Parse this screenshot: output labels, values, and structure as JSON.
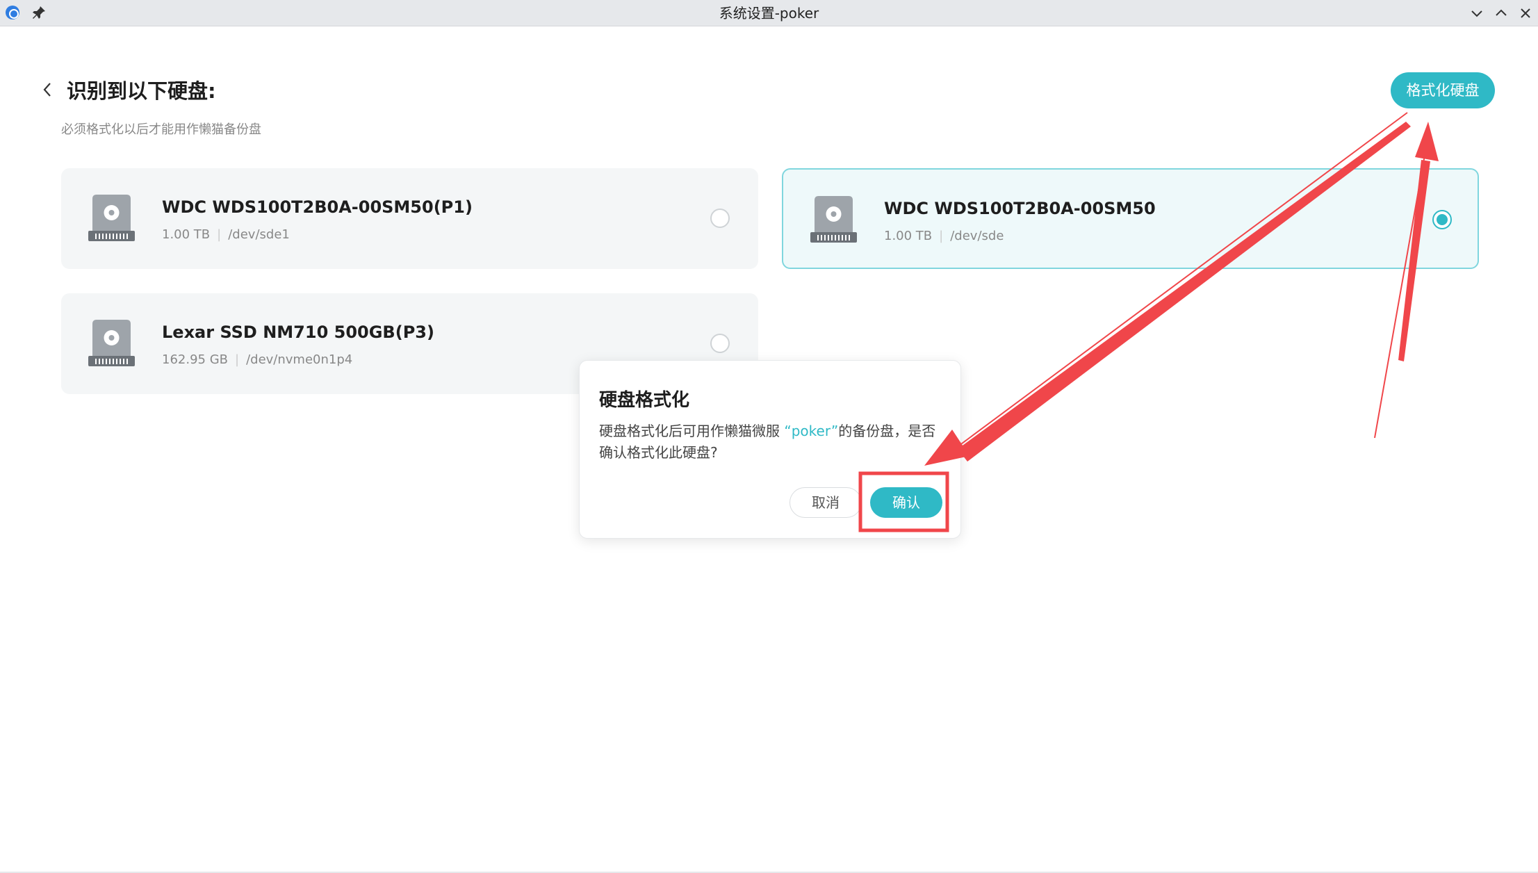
{
  "window": {
    "title": "系统设置-poker",
    "icons": {
      "app": "app-logo-icon",
      "pin": "pin-icon",
      "minimize": "chevron-down-icon",
      "maximize": "chevron-up-icon",
      "close": "close-icon"
    }
  },
  "header": {
    "back_icon": "chevron-left-icon",
    "title": "识别到以下硬盘:",
    "subtitle": "必须格式化以后才能用作懒猫备份盘",
    "format_button": "格式化硬盘"
  },
  "disks": [
    {
      "name": "WDC WDS100T2B0A-00SM50(P1)",
      "size": "1.00 TB",
      "sep": "|",
      "path": "/dev/sde1",
      "selected": false,
      "icon": "hard-drive-icon"
    },
    {
      "name": "WDC WDS100T2B0A-00SM50",
      "size": "1.00 TB",
      "sep": "|",
      "path": "/dev/sde",
      "selected": true,
      "icon": "hard-drive-icon"
    },
    {
      "name": "Lexar SSD NM710 500GB(P3)",
      "size": "162.95 GB",
      "sep": "|",
      "path": "/dev/nvme0n1p4",
      "selected": false,
      "icon": "hard-drive-icon"
    }
  ],
  "dialog": {
    "title": "硬盘格式化",
    "body_before": "硬盘格式化后可用作懒猫微服 ",
    "body_highlight": "“poker”",
    "body_after": "的备份盘，是否确认格式化此硬盘?",
    "cancel_label": "取消",
    "confirm_label": "确认"
  },
  "colors": {
    "accent": "#2fb9c6",
    "annotation": "#f0464a",
    "card_bg": "#f4f6f7",
    "selected_card_bg": "#eef9fa"
  }
}
